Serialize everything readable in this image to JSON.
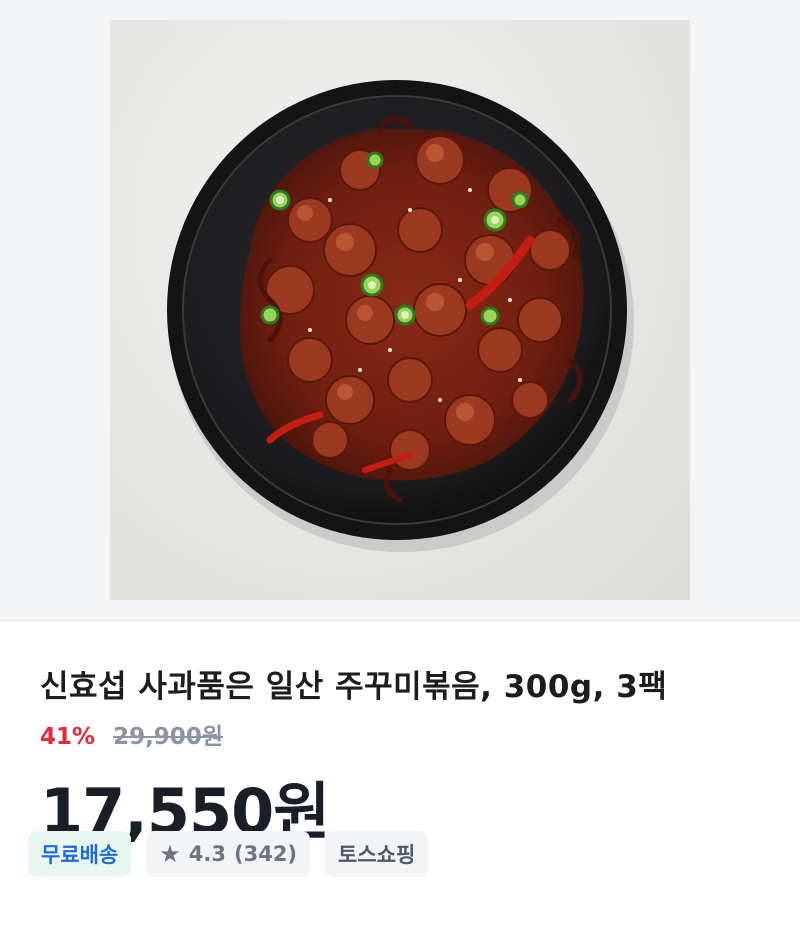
{
  "product": {
    "image_alt": "주꾸미볶음 plated on black dish",
    "title": "신효섭 사과품은 일산 주꾸미볶음, 300g, 3팩",
    "discount": "41%",
    "original_price": "29,900원",
    "price": "17,550원"
  },
  "badges": {
    "free_shipping": "무료배송",
    "rating_icon": "star-icon",
    "rating": "4.3",
    "review_count": "(342)",
    "shop": "토스쇼핑"
  },
  "colors": {
    "discount": "#e42939",
    "free_shipping_text": "#1f6ad8",
    "free_shipping_bg": "#e8f7f2"
  }
}
